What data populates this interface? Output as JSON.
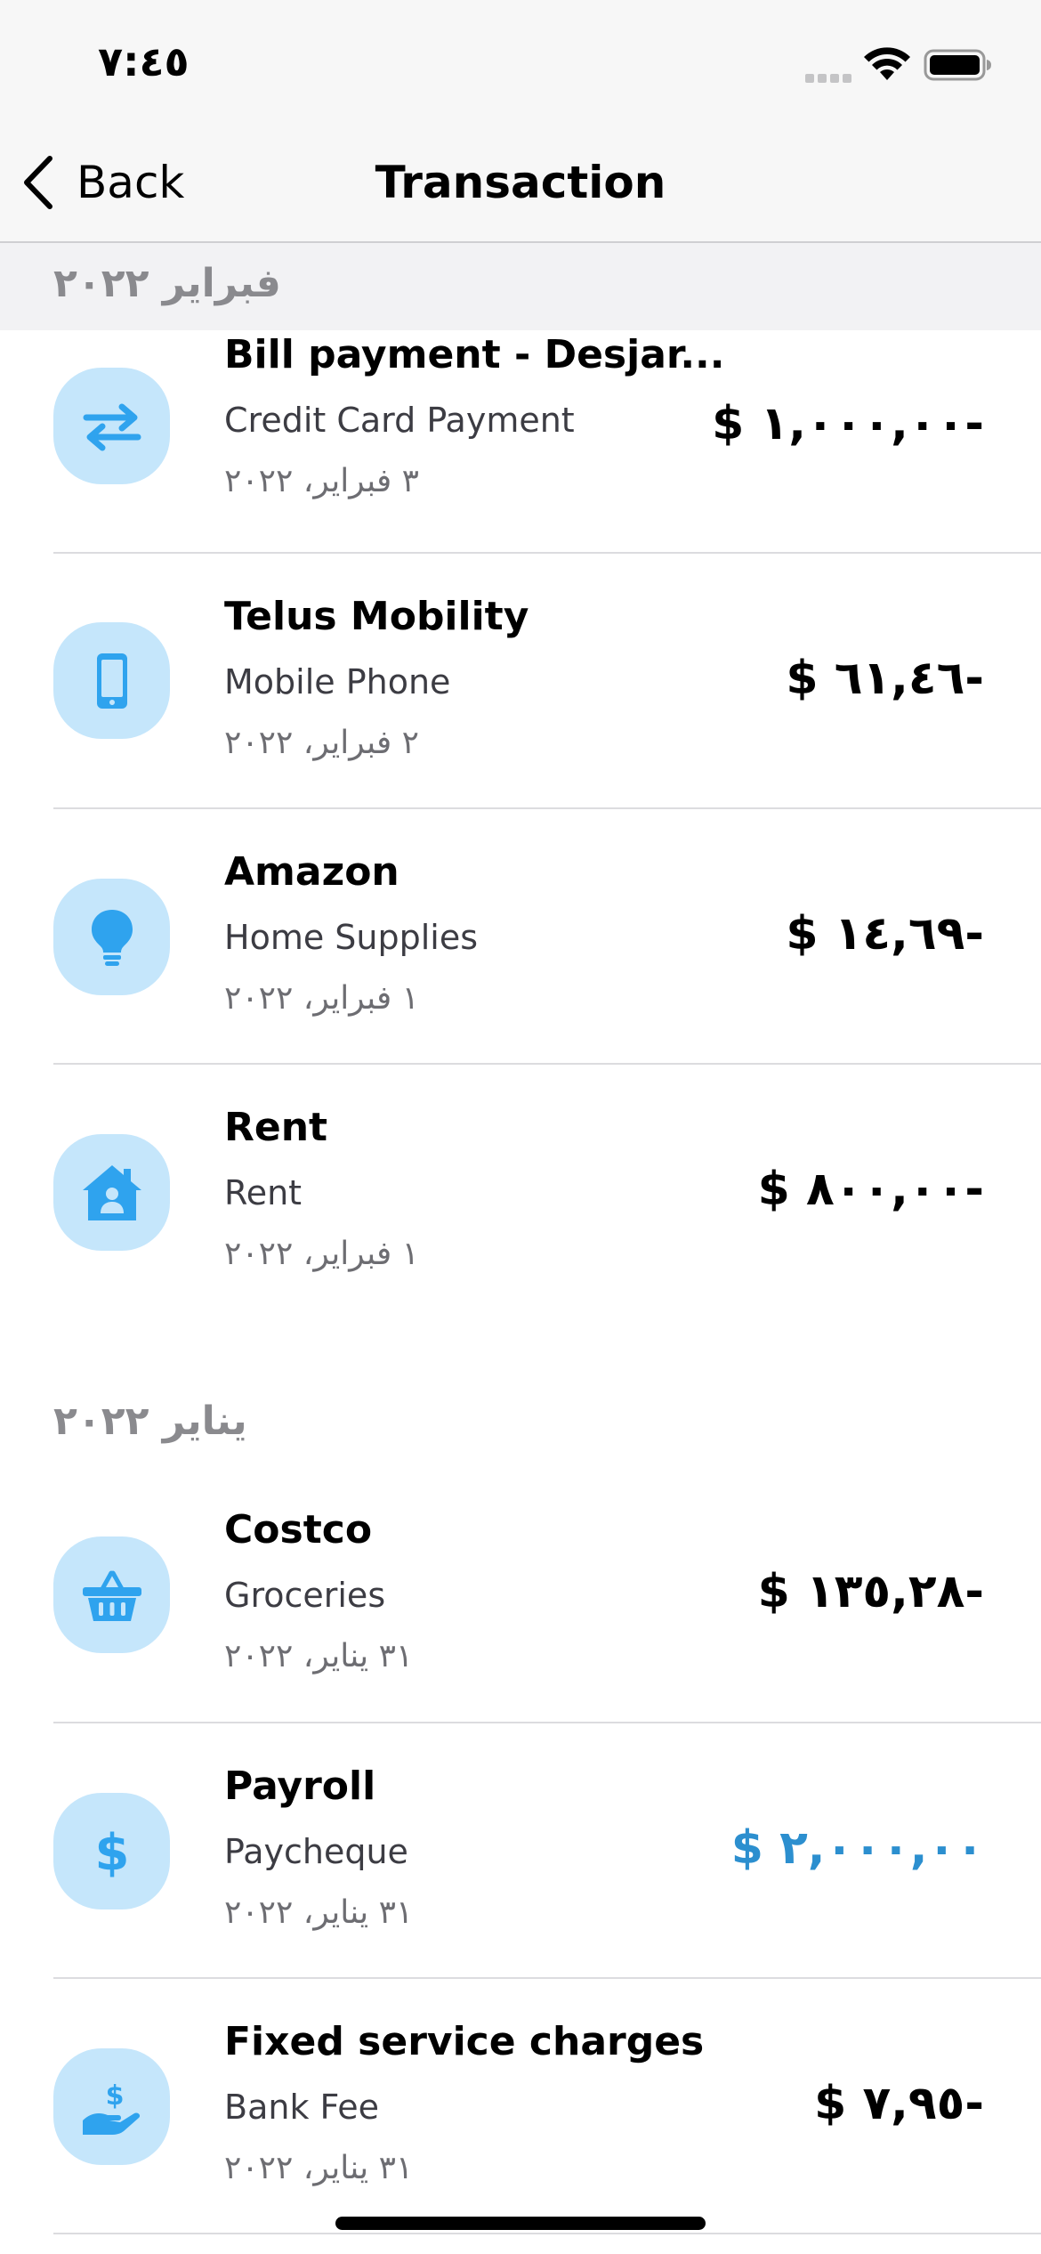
{
  "status_bar": {
    "time": "٧:٤٥"
  },
  "nav": {
    "back_label": "Back",
    "title": "Transaction"
  },
  "colors": {
    "accent": "#2c8fcf",
    "icon_bg": "#c5e6fb",
    "icon_fg": "#2fa3ee"
  },
  "sections": [
    {
      "header": "فبراير ٢٠٢٢",
      "transactions": [
        {
          "name": "Bill payment - Desjar...",
          "category": "Credit Card Payment",
          "date": "٣ فبراير، ٢٠٢٢",
          "amount": "$ ١,٠٠٠,٠٠-",
          "icon": "transfer-arrows-icon"
        },
        {
          "name": "Telus Mobility",
          "category": "Mobile Phone",
          "date": "٢ فبراير، ٢٠٢٢",
          "amount": "$ ٦١,٤٦-",
          "icon": "mobile-phone-icon"
        },
        {
          "name": "Amazon",
          "category": "Home Supplies",
          "date": "١ فبراير، ٢٠٢٢",
          "amount": "$ ١٤,٦٩-",
          "icon": "lightbulb-icon"
        },
        {
          "name": "Rent",
          "category": "Rent",
          "date": "١ فبراير، ٢٠٢٢",
          "amount": "$ ٨٠٠,٠٠-",
          "icon": "house-person-icon"
        }
      ]
    },
    {
      "header": "يناير ٢٠٢٢",
      "transactions": [
        {
          "name": "Costco",
          "category": "Groceries",
          "date": "٣١ يناير، ٢٠٢٢",
          "amount": "$ ١٣٥,٢٨-",
          "icon": "basket-icon"
        },
        {
          "name": "Payroll",
          "category": "Paycheque",
          "date": "٣١ يناير، ٢٠٢٢",
          "amount": "$ ٢,٠٠٠,٠٠",
          "icon": "dollar-icon"
        },
        {
          "name": "Fixed service charges",
          "category": "Bank Fee",
          "date": "٣١ يناير، ٢٠٢٢",
          "amount": "$ ٧,٩٥-",
          "icon": "hand-dollar-icon"
        }
      ]
    }
  ]
}
